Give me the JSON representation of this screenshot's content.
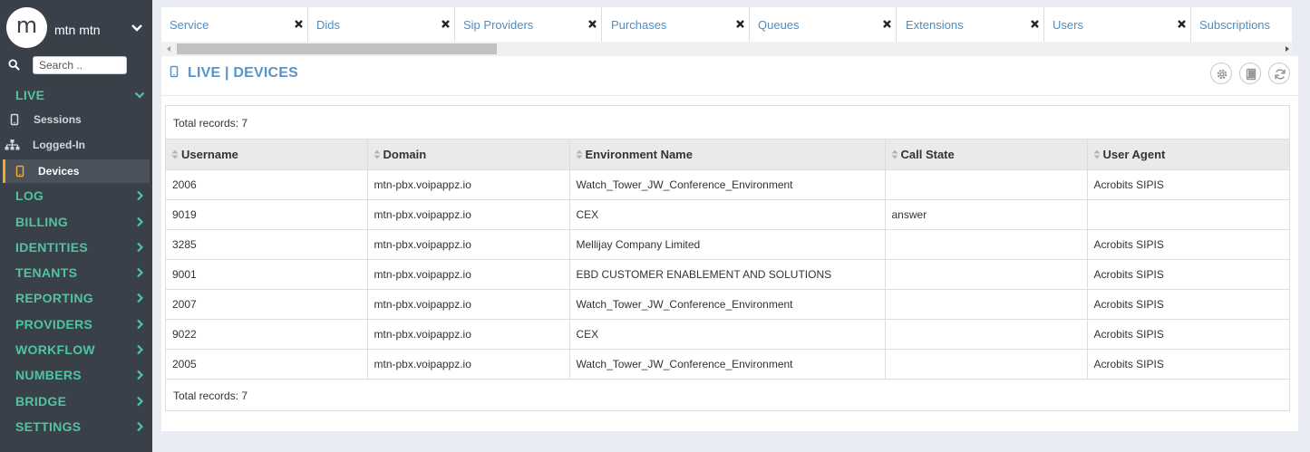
{
  "profile": {
    "avatar_letter": "m",
    "name": "mtn mtn"
  },
  "search": {
    "placeholder": "Search .."
  },
  "sidebar": {
    "live_title": "LIVE",
    "live_items": [
      {
        "label": "Sessions",
        "icon": "mobile-icon"
      },
      {
        "label": "Logged-In",
        "icon": "sitemap-icon"
      },
      {
        "label": "Devices",
        "icon": "mobile-icon",
        "active": true
      }
    ],
    "sections": [
      "LOG",
      "BILLING",
      "IDENTITIES",
      "TENANTS",
      "REPORTING",
      "PROVIDERS",
      "WORKFLOW",
      "NUMBERS",
      "BRIDGE",
      "SETTINGS"
    ]
  },
  "tabs": [
    "Service",
    "Dids",
    "Sip Providers",
    "Purchases",
    "Queues",
    "Extensions",
    "Users",
    "Subscriptions"
  ],
  "panel": {
    "title": "LIVE | DEVICES",
    "records_top": "Total records: 7",
    "records_bottom": "Total records: 7"
  },
  "table": {
    "columns": [
      "Username",
      "Domain",
      "Environment Name",
      "Call State",
      "User Agent"
    ],
    "rows": [
      [
        "2006",
        "mtn-pbx.voipappz.io",
        "Watch_Tower_JW_Conference_Environment",
        "",
        "Acrobits SIPIS"
      ],
      [
        "9019",
        "mtn-pbx.voipappz.io",
        "CEX",
        "answer",
        ""
      ],
      [
        "3285",
        "mtn-pbx.voipappz.io",
        "Mellijay Company Limited",
        "",
        "Acrobits SIPIS"
      ],
      [
        "9001",
        "mtn-pbx.voipappz.io",
        "EBD CUSTOMER ENABLEMENT AND SOLUTIONS",
        "",
        "Acrobits SIPIS"
      ],
      [
        "2007",
        "mtn-pbx.voipappz.io",
        "Watch_Tower_JW_Conference_Environment",
        "",
        "Acrobits SIPIS"
      ],
      [
        "9022",
        "mtn-pbx.voipappz.io",
        "CEX",
        "",
        "Acrobits SIPIS"
      ],
      [
        "2005",
        "mtn-pbx.voipappz.io",
        "Watch_Tower_JW_Conference_Environment",
        "",
        "Acrobits SIPIS"
      ]
    ]
  },
  "colors": {
    "sidebar_bg": "#3a4049",
    "nav_accent": "#4fc4a0",
    "active_marker": "#f4a62a",
    "link_blue": "#4c8ec4",
    "title_blue": "#5b94c3"
  }
}
